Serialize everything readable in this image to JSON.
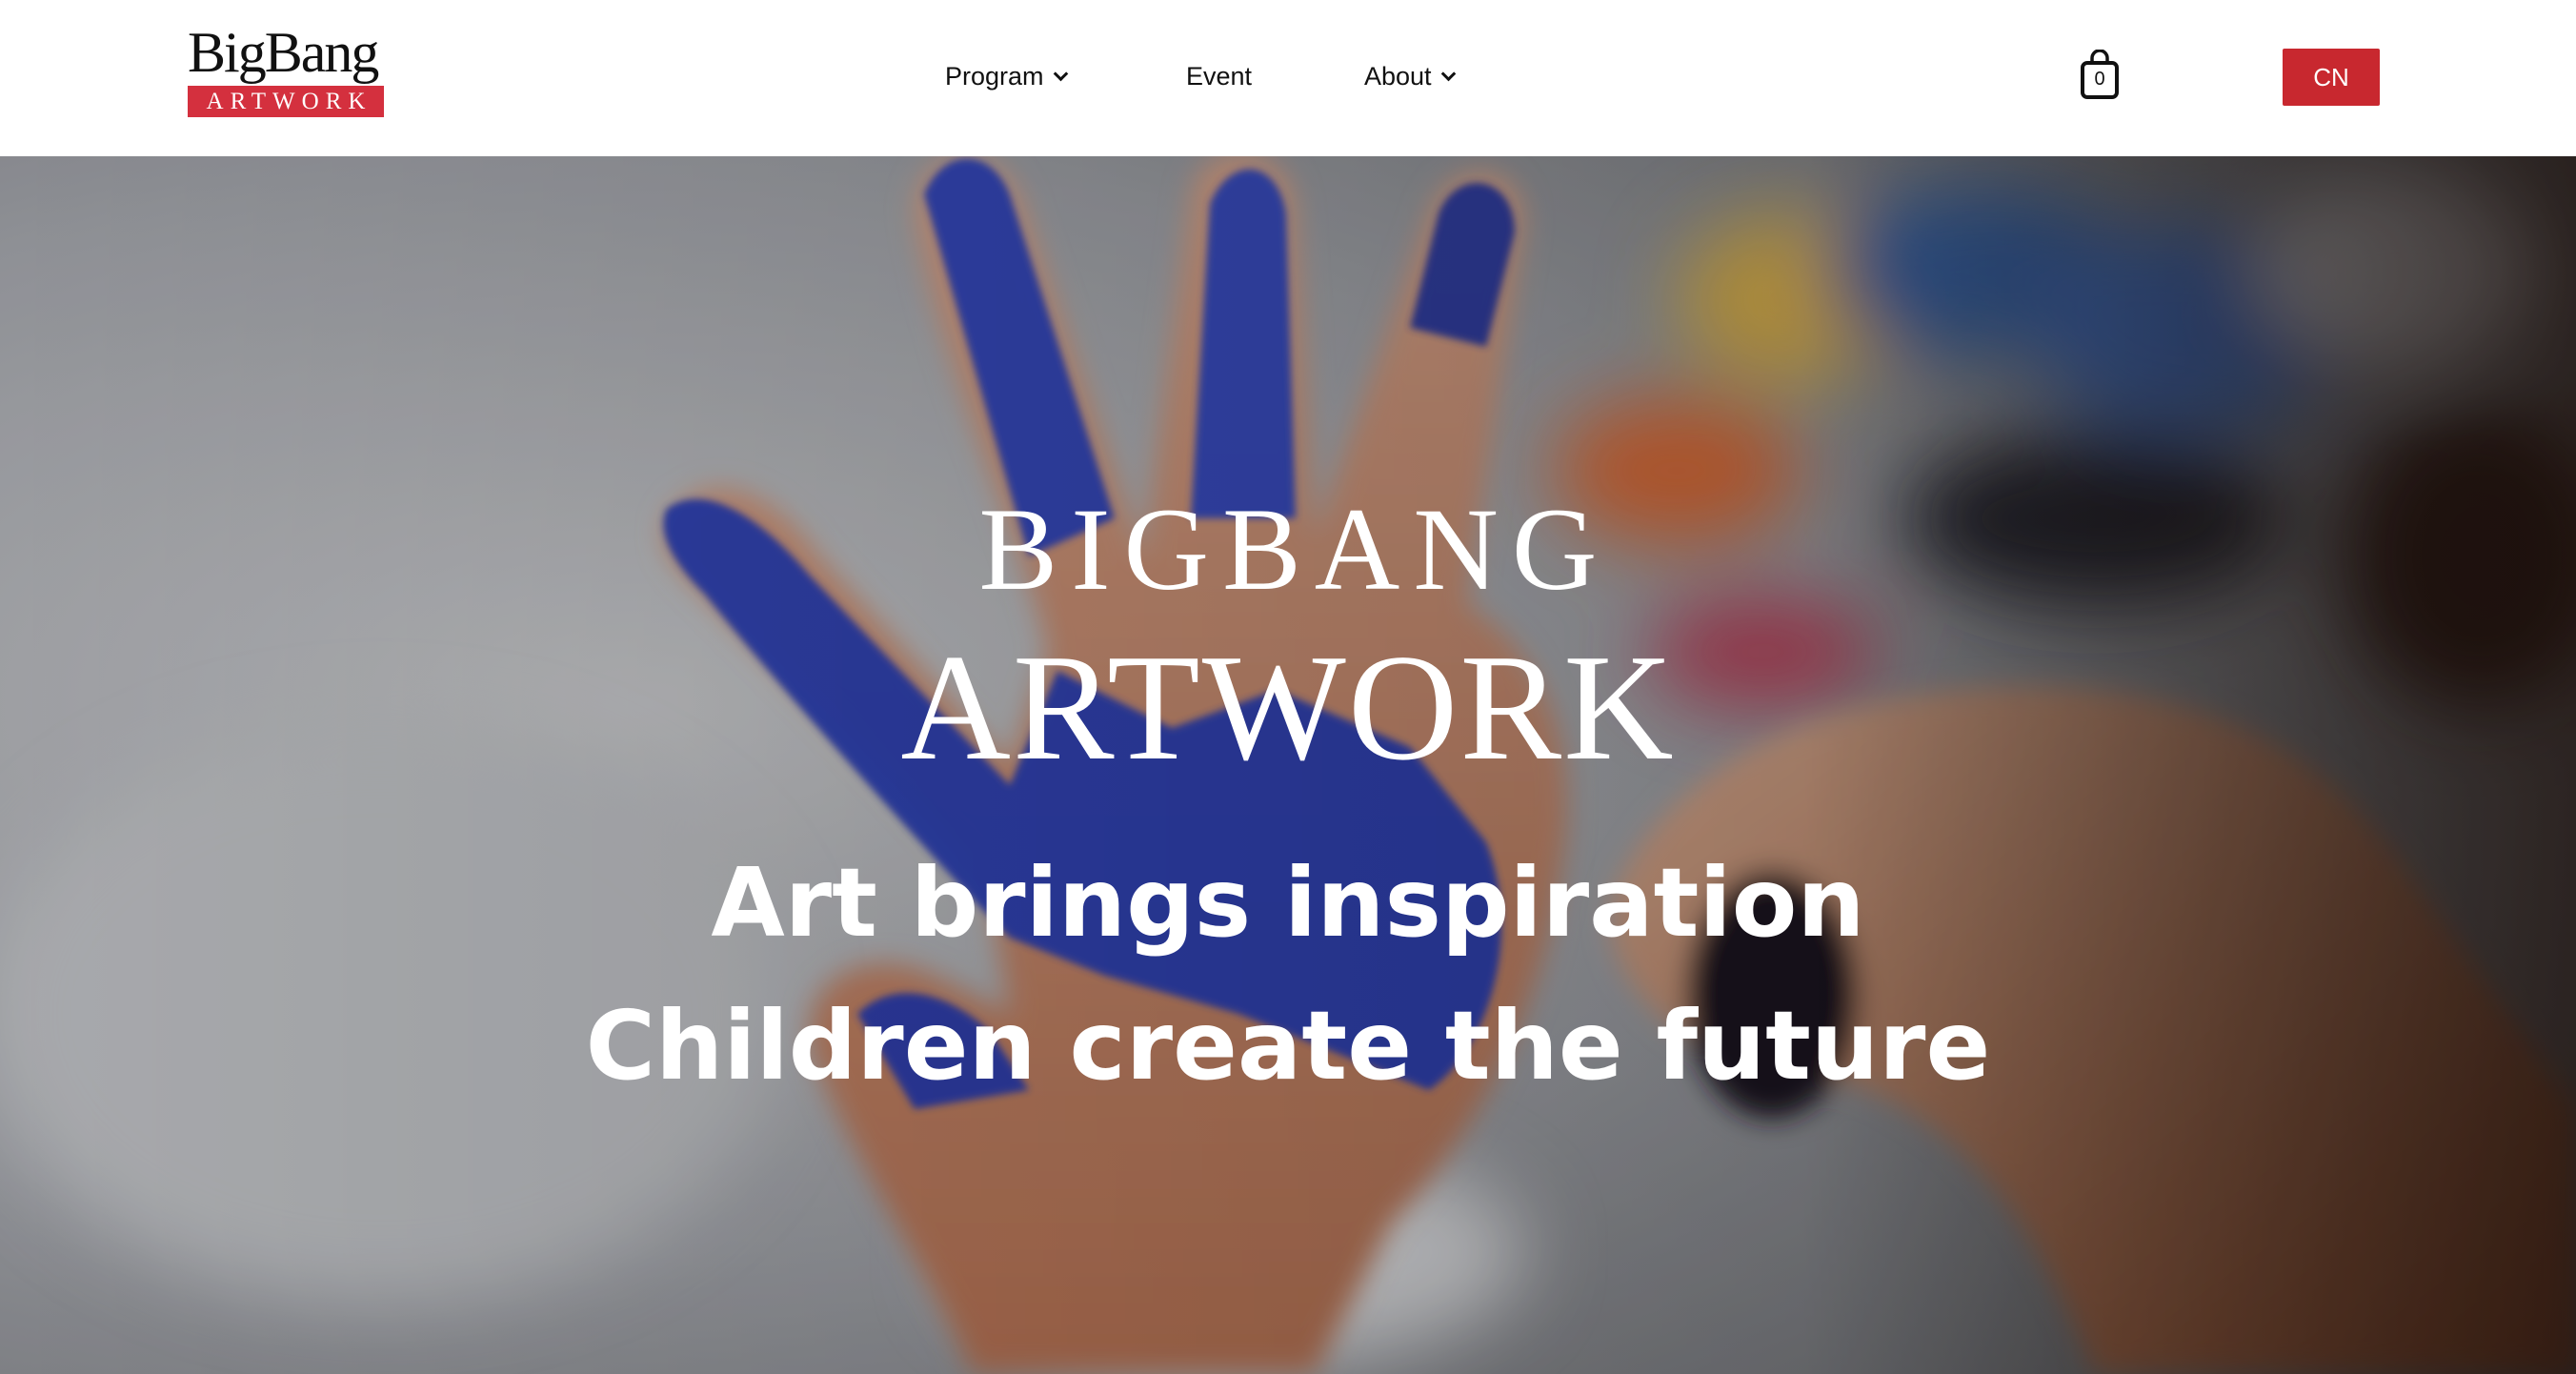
{
  "header": {
    "logo": {
      "word": "BigBang",
      "subword": "ARTWORK",
      "bar_color": "#d4303e"
    },
    "nav": [
      {
        "label": "Program",
        "has_dropdown": true
      },
      {
        "label": "Event",
        "has_dropdown": false
      },
      {
        "label": "About",
        "has_dropdown": true
      }
    ],
    "cart": {
      "count": "0",
      "icon": "shopping-bag-icon"
    },
    "language_button": {
      "label": "CN",
      "color": "#c8282f"
    }
  },
  "hero": {
    "brand_line_1": "BIGBANG",
    "brand_line_2": "ARTWORK",
    "tagline_1": "Art brings inspiration",
    "tagline_2": "Children create the future",
    "background": "blurred photo of a child's hand covered in blue paint"
  }
}
